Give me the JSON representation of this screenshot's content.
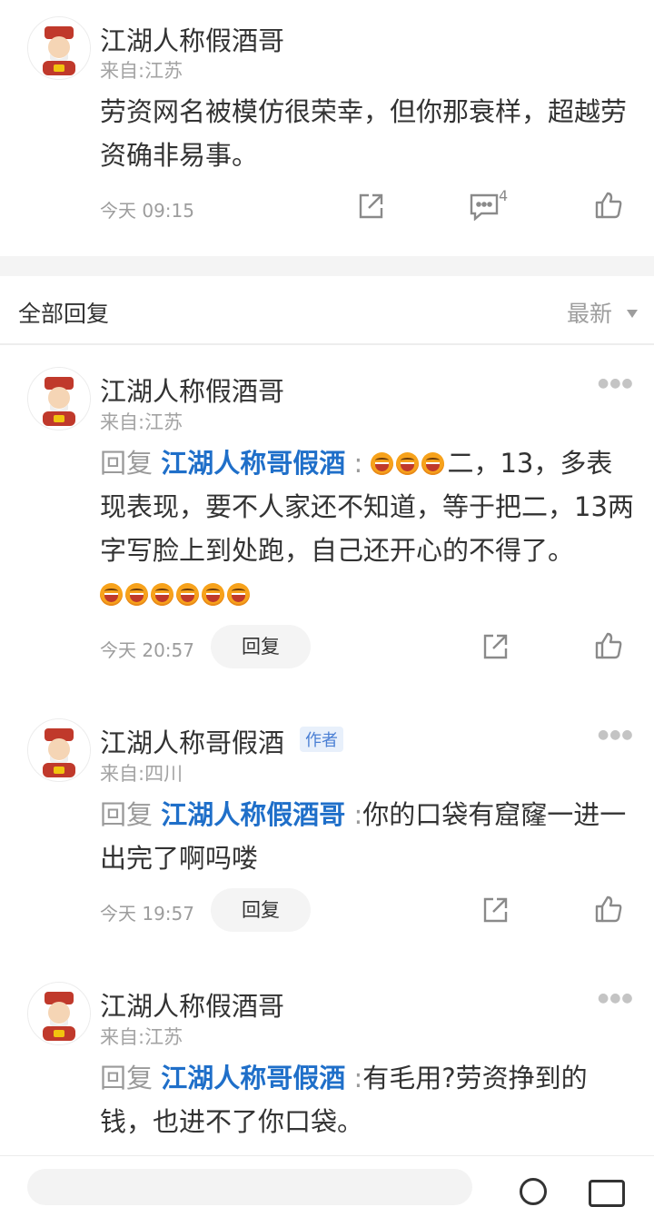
{
  "top_comment": {
    "username": "江湖人称假酒哥",
    "location": "来自:江苏",
    "text": "劳资网名被模仿很荣幸，但你那衰样，超越劳资确非易事。",
    "time": "今天 09:15",
    "comment_count": "4"
  },
  "replies_header": {
    "title": "全部回复",
    "sort_label": "最新"
  },
  "replies": [
    {
      "username": "江湖人称假酒哥",
      "location": "来自:江苏",
      "reply_prefix": "回复",
      "mention": "江湖人称哥假酒",
      "colon": ":",
      "text": "二，13，多表现表现，要不人家还不知道，等于把二，13两字写脸上到处跑，自己还开心的不得了。",
      "time": "今天 20:57",
      "reply_label": "回复"
    },
    {
      "username": "江湖人称哥假酒",
      "author_badge": "作者",
      "location": "来自:四川",
      "reply_prefix": "回复",
      "mention": "江湖人称假酒哥",
      "colon": ":",
      "text": "你的口袋有窟窿一进一出完了啊吗喽",
      "time": "今天 19:57",
      "reply_label": "回复"
    },
    {
      "username": "江湖人称假酒哥",
      "location": "来自:江苏",
      "reply_prefix": "回复",
      "mention": "江湖人称哥假酒",
      "colon": ":",
      "text": "有毛用?劳资挣到的钱，也进不了你口袋。"
    }
  ],
  "icons": {
    "share": "share-icon",
    "comment": "comment-icon",
    "like": "thumbs-up-icon",
    "more": "more-dots-icon",
    "laugh_emoji": "laughing-emoji-icon",
    "sort_caret": "caret-down-icon"
  },
  "colors": {
    "mention": "#1f6fc9",
    "badge_bg": "#e8f0fb",
    "badge_text": "#4a7fd4",
    "meta_gray": "#9d9d9d"
  }
}
